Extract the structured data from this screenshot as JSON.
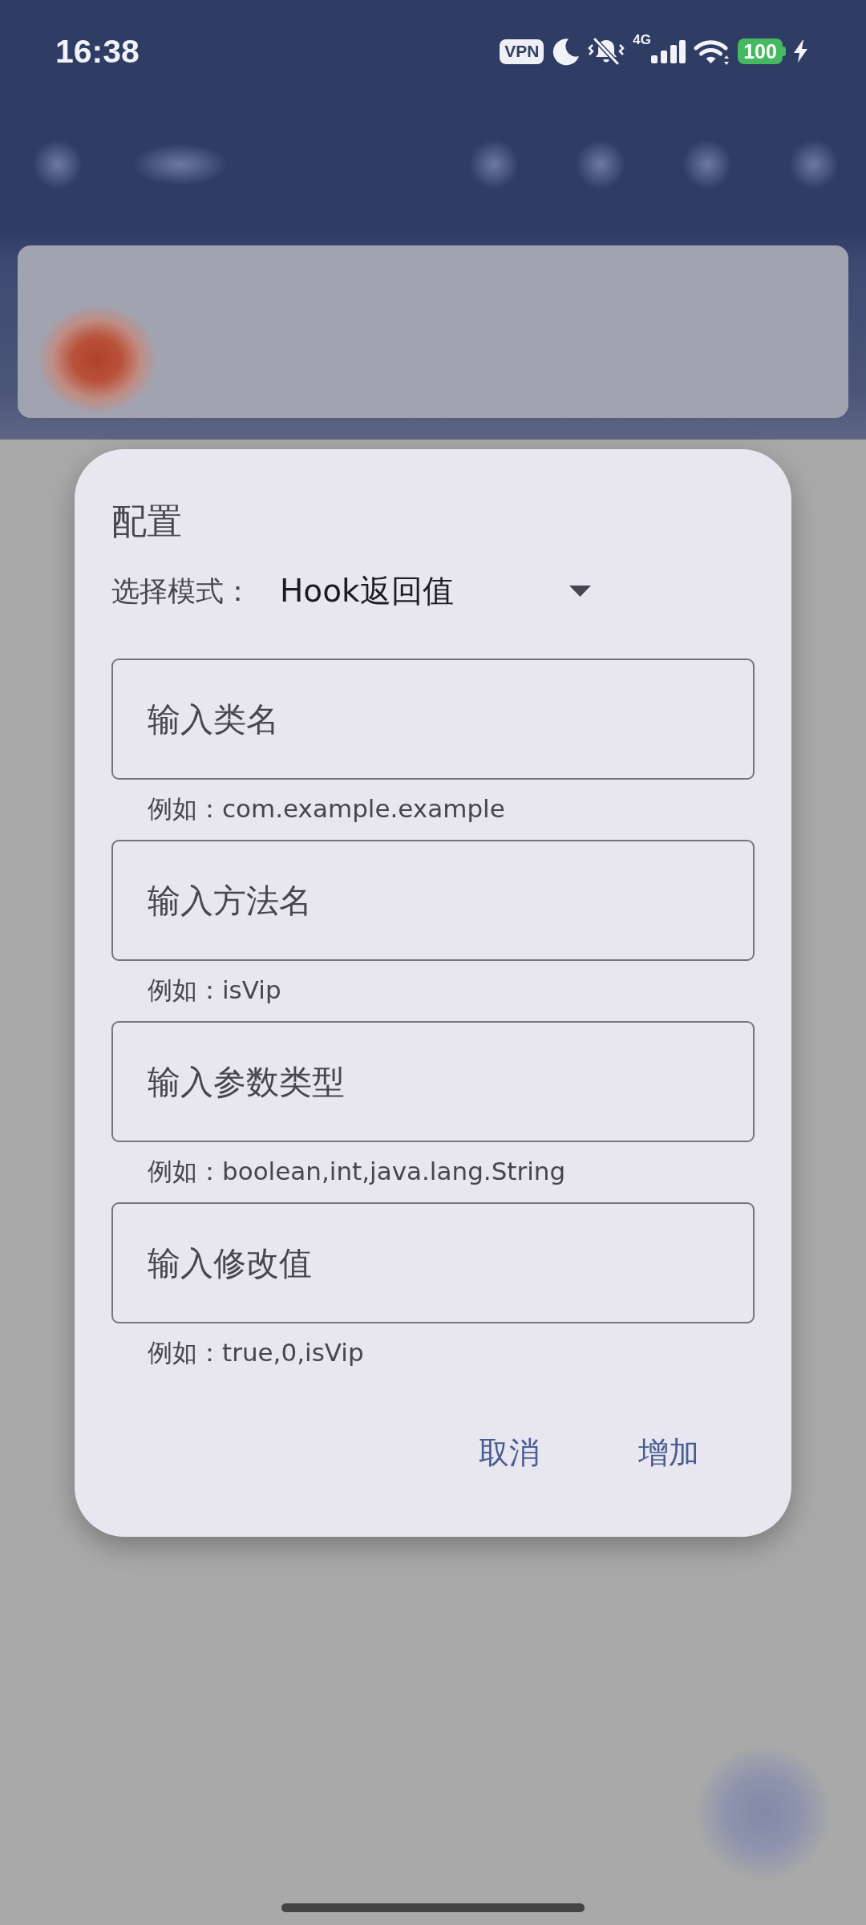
{
  "status_bar": {
    "time": "16:38",
    "vpn": "VPN",
    "network_type": "4G",
    "battery": "100",
    "charging": true
  },
  "dialog": {
    "title": "配置",
    "mode_selector": {
      "label": "选择模式：",
      "value": "Hook返回值"
    },
    "fields": [
      {
        "placeholder": "输入类名",
        "helper": "例如：com.example.example"
      },
      {
        "placeholder": "输入方法名",
        "helper": "例如：isVip"
      },
      {
        "placeholder": "输入参数类型",
        "helper": "例如：boolean,int,java.lang.String"
      },
      {
        "placeholder": "输入修改值",
        "helper": "例如：true,0,isVip"
      }
    ],
    "buttons": [
      "取消",
      "增加"
    ]
  }
}
